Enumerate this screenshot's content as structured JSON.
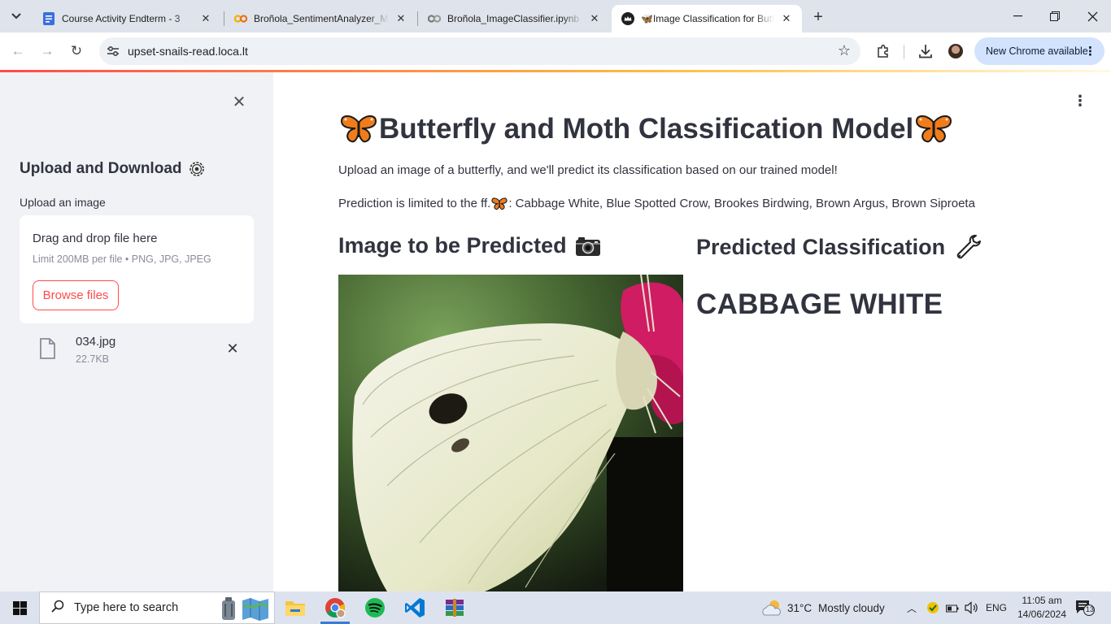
{
  "browser": {
    "tabs": [
      {
        "title": "Course Activity Endterm - 3",
        "favicon": "forms-icon",
        "active": false
      },
      {
        "title": "Broñola_SentimentAnalyzer_Mc",
        "favicon": "colab-icon",
        "active": false
      },
      {
        "title": "Broñola_ImageClassifier.ipynb -",
        "favicon": "colab-gray-icon",
        "active": false
      },
      {
        "title": "🦋Image Classification for Butt",
        "favicon": "streamlit-crown-icon",
        "active": true
      }
    ],
    "url": "upset-snails-read.loca.lt",
    "new_chrome_label": "New Chrome available"
  },
  "sidebar": {
    "heading": "Upload and Download",
    "upload_label": "Upload an image",
    "dropzone_title": "Drag and drop file here",
    "dropzone_limit": "Limit 200MB per file • PNG, JPG, JPEG",
    "browse_label": "Browse files",
    "file": {
      "name": "034.jpg",
      "size": "22.7KB"
    }
  },
  "main": {
    "title": "Butterfly and Moth Classification Model",
    "description": "Upload an image of a butterfly, and we'll predict its classification based on our trained model!",
    "limits_prefix": "Prediction is limited to the ff.",
    "limits_list": ": Cabbage White, Blue Spotted Crow, Brookes Birdwing, Brown Argus, Brown Siproeta",
    "left_heading": "Image to be Predicted",
    "right_heading": "Predicted Classification",
    "prediction": "CABBAGE WHITE"
  },
  "taskbar": {
    "search_placeholder": "Type here to search",
    "weather_temp": "31°C",
    "weather_desc": "Mostly cloudy",
    "language": "ENG",
    "time": "11:05 am",
    "date": "14/06/2024",
    "notification_count": "13"
  },
  "colors": {
    "streamlit_red": "#ff4b4b",
    "sidebar_bg": "#f0f2f6",
    "text": "#31333f",
    "chrome_frame": "#dfe3eb",
    "new_chrome_pill": "#d3e3fd"
  }
}
